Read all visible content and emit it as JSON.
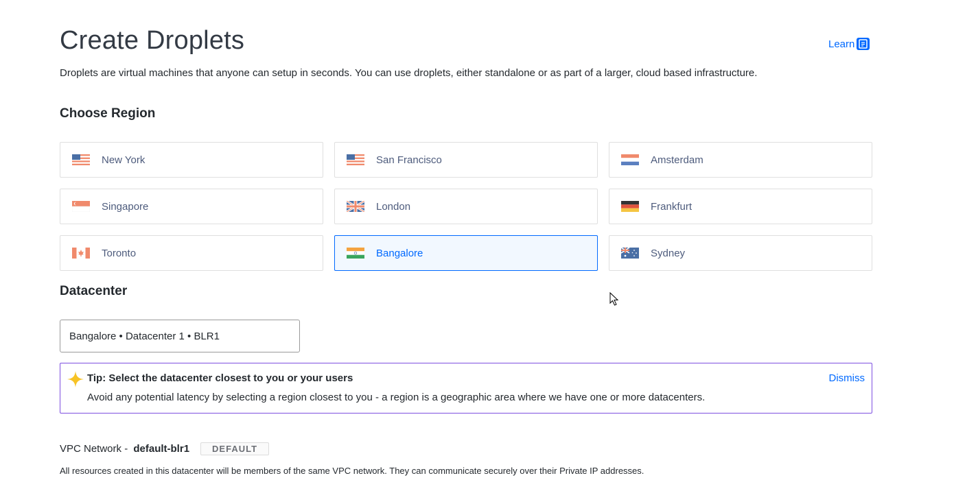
{
  "header": {
    "title": "Create Droplets",
    "learn_label": "Learn",
    "subtitle": "Droplets are virtual machines that anyone can setup in seconds. You can use droplets, either standalone or as part of a larger, cloud based infrastructure."
  },
  "region_section": {
    "title": "Choose Region",
    "selected": "Bangalore",
    "regions": [
      {
        "label": "New York",
        "flag": "us-flag-icon"
      },
      {
        "label": "San Francisco",
        "flag": "us-flag-icon"
      },
      {
        "label": "Amsterdam",
        "flag": "netherlands-flag-icon"
      },
      {
        "label": "Singapore",
        "flag": "singapore-flag-icon"
      },
      {
        "label": "London",
        "flag": "uk-flag-icon"
      },
      {
        "label": "Frankfurt",
        "flag": "germany-flag-icon"
      },
      {
        "label": "Toronto",
        "flag": "canada-flag-icon"
      },
      {
        "label": "Bangalore",
        "flag": "india-flag-icon"
      },
      {
        "label": "Sydney",
        "flag": "australia-flag-icon"
      }
    ]
  },
  "datacenter": {
    "title": "Datacenter",
    "value": "Bangalore • Datacenter 1 • BLR1"
  },
  "tip": {
    "title": "Tip: Select the datacenter closest to you or your users",
    "body": "Avoid any potential latency by selecting a region closest to you - a region is a geographic area where we have one or more datacenters.",
    "dismiss_label": "Dismiss"
  },
  "vpc": {
    "prefix": "VPC Network - ",
    "name": "default-blr1",
    "badge": "DEFAULT",
    "description": "All resources created in this datacenter will be members of the same VPC network. They can communicate securely over their Private IP addresses."
  },
  "colors": {
    "accent": "#0069ff",
    "tip_border": "#7d4ee0",
    "selected_bg": "#f2f8ff"
  }
}
